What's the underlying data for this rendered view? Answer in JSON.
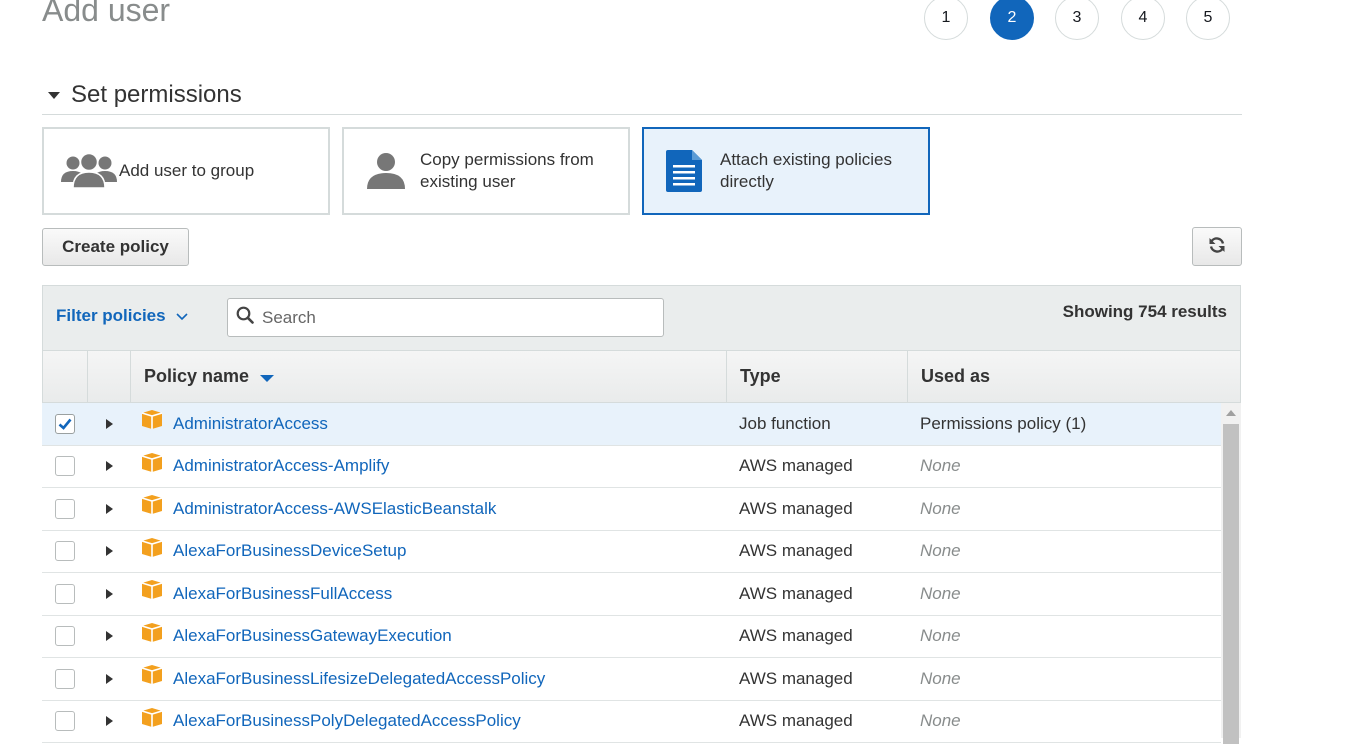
{
  "page": {
    "title": "Add user"
  },
  "steps": [
    {
      "label": "1",
      "active": false
    },
    {
      "label": "2",
      "active": true
    },
    {
      "label": "3",
      "active": false
    },
    {
      "label": "4",
      "active": false
    },
    {
      "label": "5",
      "active": false
    }
  ],
  "section": {
    "title": "Set permissions"
  },
  "options": {
    "add_group": {
      "label": "Add user to group",
      "icon": "users-group-icon"
    },
    "copy_user": {
      "label_line1": "Copy permissions from",
      "label_line2": "existing user",
      "icon": "user-icon"
    },
    "attach": {
      "label_line1": "Attach existing policies",
      "label_line2": "directly",
      "icon": "document-icon",
      "selected": true
    }
  },
  "toolbar": {
    "create_policy_label": "Create policy",
    "refresh_icon": "refresh-icon"
  },
  "filter": {
    "label": "Filter policies",
    "search_placeholder": "Search",
    "results_text": "Showing 754 results"
  },
  "table": {
    "columns": {
      "name": "Policy name",
      "type": "Type",
      "used_as": "Used as"
    },
    "rows": [
      {
        "name": "AdministratorAccess",
        "type": "Job function",
        "used_as": "Permissions policy (1)",
        "checked": true
      },
      {
        "name": "AdministratorAccess-Amplify",
        "type": "AWS managed",
        "used_as": "None",
        "checked": false
      },
      {
        "name": "AdministratorAccess-AWSElasticBeanstalk",
        "type": "AWS managed",
        "used_as": "None",
        "checked": false
      },
      {
        "name": "AlexaForBusinessDeviceSetup",
        "type": "AWS managed",
        "used_as": "None",
        "checked": false
      },
      {
        "name": "AlexaForBusinessFullAccess",
        "type": "AWS managed",
        "used_as": "None",
        "checked": false
      },
      {
        "name": "AlexaForBusinessGatewayExecution",
        "type": "AWS managed",
        "used_as": "None",
        "checked": false
      },
      {
        "name": "AlexaForBusinessLifesizeDelegatedAccessPolicy",
        "type": "AWS managed",
        "used_as": "None",
        "checked": false
      },
      {
        "name": "AlexaForBusinessPolyDelegatedAccessPolicy",
        "type": "AWS managed",
        "used_as": "None",
        "checked": false
      }
    ]
  },
  "colors": {
    "accent": "#1166bb",
    "selected_bg": "#e8f2fb",
    "package_icon": "#f3a01e"
  }
}
